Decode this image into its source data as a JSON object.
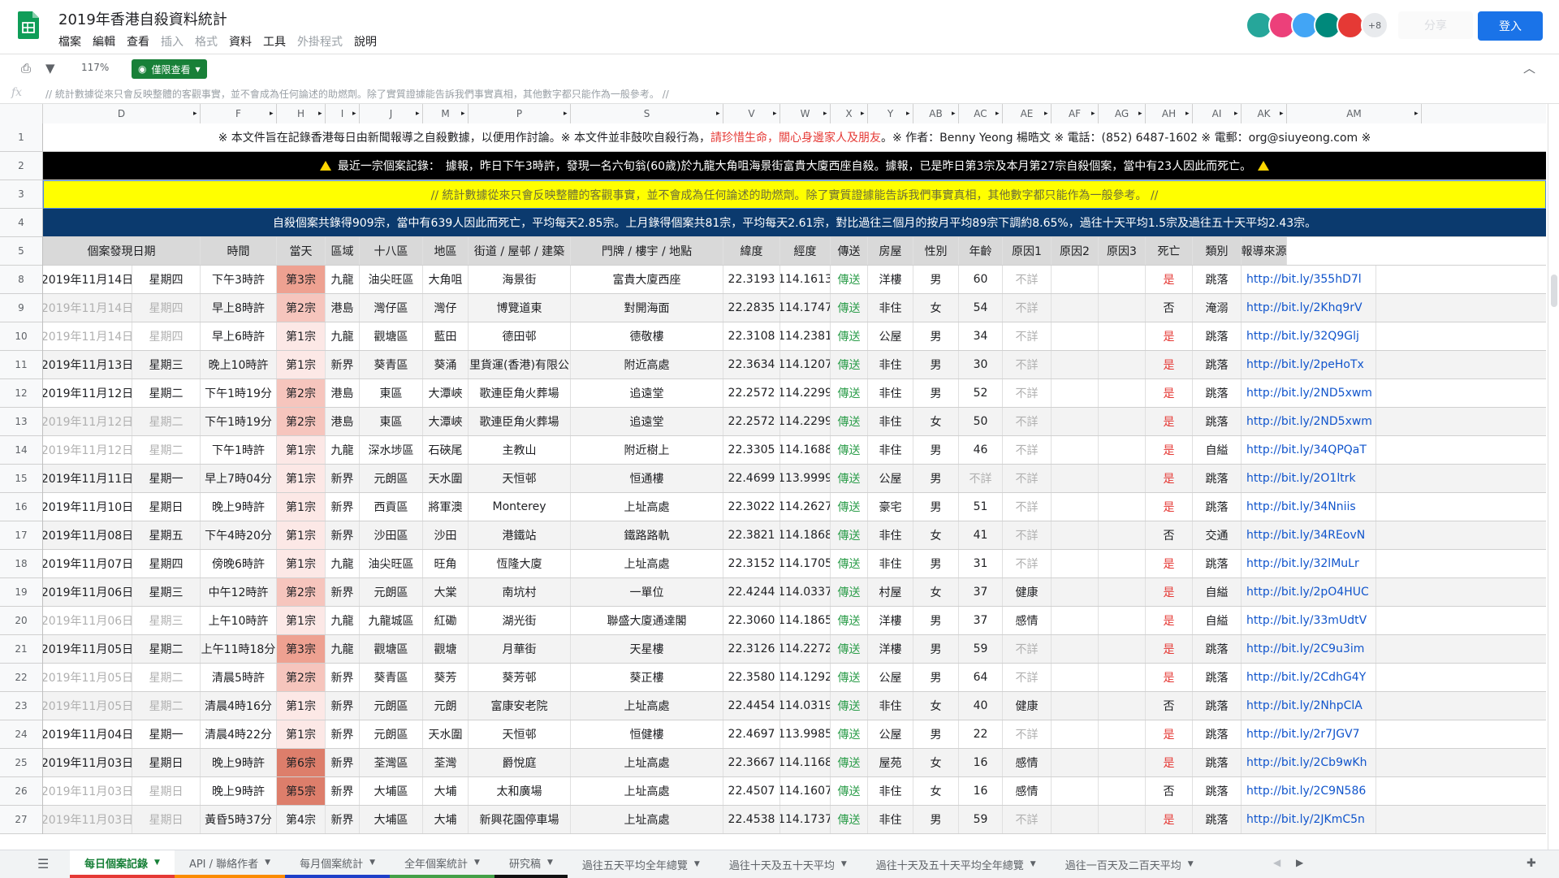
{
  "app": {
    "title": "2019年香港自殺資料統計",
    "menu": [
      "檔案",
      "編輯",
      "查看",
      "插入",
      "格式",
      "資料",
      "工具",
      "外掛程式",
      "說明"
    ],
    "menu_dim": [
      false,
      false,
      false,
      true,
      true,
      false,
      false,
      true,
      false
    ],
    "avatars_more": "+8",
    "share_label": "分享",
    "login_label": "登入"
  },
  "toolbar": {
    "zoom": "117%",
    "view_only_label": "僅限查看"
  },
  "formula": {
    "fx": "fx",
    "text": "// 統計數據從來只會反映整體的客觀事實，並不會成為任何論述的助燃劑。除了實質證據能告訴我們事實真相，其他數字都只能作為一般參考。 //"
  },
  "columns": [
    "D",
    "F",
    "H",
    "I",
    "J",
    "M",
    "P",
    "S",
    "V",
    "W",
    "X",
    "Y",
    "AB",
    "AC",
    "AE",
    "AF",
    "AG",
    "AH",
    "AI",
    "AK",
    "AM"
  ],
  "banners": {
    "row1_a": "※ 本文件旨在記錄香港每日由新聞報導之自殺數據，以便用作討論。※ 本文件並非鼓吹自殺行為，",
    "row1_red": "請珍惜生命，關心身邊家人及朋友",
    "row1_b": "。※ 作者：Benny Yeong 楊晧文 ※ 電話：(852) 6487-1602 ※ 電郵：org@siuyeong.com ※",
    "row2": "最近一宗個案記錄：　據報，昨日下午3時許，發現一名六旬翁(60歲)於九龍大角咀海景街富貴大廈西座自殺。據報，已是昨日第3宗及本月第27宗自殺個案，當中有23人因此而死亡。",
    "row3": "// 統計數據從來只會反映整體的客觀事實，並不會成為任何論述的助燃劑。除了實質證據能告訴我們事實真相，其他數字都只能作為一般參考。 //",
    "row4": "自殺個案共錄得909宗，當中有639人因此而死亡，平均每天2.85宗。上月錄得個案共81宗，平均每天2.61宗，對比過往三個月的按月平均89宗下調約8.65%，過往十天平均1.5宗及過往五十天平均2.43宗。"
  },
  "row_numbers": [
    "1",
    "2",
    "3",
    "4",
    "5",
    "8",
    "9",
    "10",
    "11",
    "12",
    "13",
    "14",
    "15",
    "16",
    "17",
    "18",
    "19",
    "20",
    "21",
    "22",
    "23",
    "24",
    "25",
    "26",
    "27"
  ],
  "table": {
    "headers": [
      "個案發現日期",
      "時間",
      "當天",
      "區域",
      "十八區",
      "地區",
      "街道 / 屋邨 / 建築",
      "門牌 / 樓宇 / 地點",
      "緯度",
      "經度",
      "傳送",
      "房屋",
      "性別",
      "年齡",
      "原因1",
      "原因2",
      "原因3",
      "死亡",
      "類別",
      "報導來源"
    ],
    "rows": [
      {
        "date": "2019年11月14日",
        "wd": "星期四",
        "time": "下午3時許",
        "n": "第3宗",
        "rg": "九龍",
        "d18": "油尖旺區",
        "area": "大角咀",
        "street": "海景街",
        "place": "富貴大廈西座",
        "lat": "22.3193",
        "lng": "114.1613",
        "tx": "傳送",
        "house": "洋樓",
        "sex": "男",
        "age": "60",
        "r1": "不詳",
        "dead": "是",
        "cat": "跳落",
        "src": "http://bit.ly/355hD7l",
        "dim": false,
        "lvl": 3
      },
      {
        "date": "2019年11月14日",
        "wd": "星期四",
        "time": "早上8時許",
        "n": "第2宗",
        "rg": "港島",
        "d18": "灣仔區",
        "area": "灣仔",
        "street": "博覽道東",
        "place": "對開海面",
        "lat": "22.2835",
        "lng": "114.1747",
        "tx": "傳送",
        "house": "非住",
        "sex": "女",
        "age": "54",
        "r1": "不詳",
        "dead": "否",
        "cat": "淹溺",
        "src": "http://bit.ly/2Khq9rV",
        "dim": true,
        "lvl": 2
      },
      {
        "date": "2019年11月14日",
        "wd": "星期四",
        "time": "早上6時許",
        "n": "第1宗",
        "rg": "九龍",
        "d18": "觀塘區",
        "area": "藍田",
        "street": "德田邨",
        "place": "德敬樓",
        "lat": "22.3108",
        "lng": "114.2381",
        "tx": "傳送",
        "house": "公屋",
        "sex": "男",
        "age": "34",
        "r1": "不詳",
        "dead": "是",
        "cat": "跳落",
        "src": "http://bit.ly/32Q9Glj",
        "dim": true,
        "lvl": 1
      },
      {
        "date": "2019年11月13日",
        "wd": "星期三",
        "time": "晚上10時許",
        "n": "第1宗",
        "rg": "新界",
        "d18": "葵青區",
        "area": "葵涌",
        "street": "嘉里貨運(香港)有限公司",
        "place": "附近高處",
        "lat": "22.3634",
        "lng": "114.1207",
        "tx": "傳送",
        "house": "非住",
        "sex": "男",
        "age": "30",
        "r1": "不詳",
        "dead": "是",
        "cat": "跳落",
        "src": "http://bit.ly/2peHoTx",
        "dim": false,
        "lvl": 1
      },
      {
        "date": "2019年11月12日",
        "wd": "星期二",
        "time": "下午1時19分",
        "n": "第2宗",
        "rg": "港島",
        "d18": "東區",
        "area": "大潭峽",
        "street": "歌連臣角火葬場",
        "place": "追遠堂",
        "lat": "22.2572",
        "lng": "114.2299",
        "tx": "傳送",
        "house": "非住",
        "sex": "男",
        "age": "52",
        "r1": "不詳",
        "dead": "是",
        "cat": "跳落",
        "src": "http://bit.ly/2ND5xwm",
        "dim": false,
        "lvl": 2
      },
      {
        "date": "2019年11月12日",
        "wd": "星期二",
        "time": "下午1時19分",
        "n": "第2宗",
        "rg": "港島",
        "d18": "東區",
        "area": "大潭峽",
        "street": "歌連臣角火葬場",
        "place": "追遠堂",
        "lat": "22.2572",
        "lng": "114.2299",
        "tx": "傳送",
        "house": "非住",
        "sex": "女",
        "age": "50",
        "r1": "不詳",
        "dead": "是",
        "cat": "跳落",
        "src": "http://bit.ly/2ND5xwm",
        "dim": true,
        "lvl": 2
      },
      {
        "date": "2019年11月12日",
        "wd": "星期二",
        "time": "下午1時許",
        "n": "第1宗",
        "rg": "九龍",
        "d18": "深水埗區",
        "area": "石硤尾",
        "street": "主教山",
        "place": "附近樹上",
        "lat": "22.3305",
        "lng": "114.1688",
        "tx": "傳送",
        "house": "非住",
        "sex": "男",
        "age": "46",
        "r1": "不詳",
        "dead": "是",
        "cat": "自縊",
        "src": "http://bit.ly/34QPQaT",
        "dim": true,
        "lvl": 1
      },
      {
        "date": "2019年11月11日",
        "wd": "星期一",
        "time": "早上7時04分",
        "n": "第1宗",
        "rg": "新界",
        "d18": "元朗區",
        "area": "天水圍",
        "street": "天恒邨",
        "place": "恒通樓",
        "lat": "22.4699",
        "lng": "113.9999",
        "tx": "傳送",
        "house": "公屋",
        "sex": "男",
        "age": "不詳",
        "r1": "不詳",
        "dead": "是",
        "cat": "跳落",
        "src": "http://bit.ly/2O1ltrk",
        "dim": false,
        "lvl": 1
      },
      {
        "date": "2019年11月10日",
        "wd": "星期日",
        "time": "晚上9時許",
        "n": "第1宗",
        "rg": "新界",
        "d18": "西貢區",
        "area": "將軍澳",
        "street": "Monterey",
        "place": "上址高處",
        "lat": "22.3022",
        "lng": "114.2627",
        "tx": "傳送",
        "house": "豪宅",
        "sex": "男",
        "age": "51",
        "r1": "不詳",
        "dead": "是",
        "cat": "跳落",
        "src": "http://bit.ly/34Nniis",
        "dim": false,
        "lvl": 1
      },
      {
        "date": "2019年11月08日",
        "wd": "星期五",
        "time": "下午4時20分",
        "n": "第1宗",
        "rg": "新界",
        "d18": "沙田區",
        "area": "沙田",
        "street": "港鐵站",
        "place": "鐵路路軌",
        "lat": "22.3821",
        "lng": "114.1868",
        "tx": "傳送",
        "house": "非住",
        "sex": "女",
        "age": "41",
        "r1": "不詳",
        "dead": "否",
        "cat": "交通",
        "src": "http://bit.ly/34REovN",
        "dim": false,
        "lvl": 1
      },
      {
        "date": "2019年11月07日",
        "wd": "星期四",
        "time": "傍晚6時許",
        "n": "第1宗",
        "rg": "九龍",
        "d18": "油尖旺區",
        "area": "旺角",
        "street": "恆隆大廈",
        "place": "上址高處",
        "lat": "22.3152",
        "lng": "114.1705",
        "tx": "傳送",
        "house": "非住",
        "sex": "男",
        "age": "31",
        "r1": "不詳",
        "dead": "是",
        "cat": "跳落",
        "src": "http://bit.ly/32lMuLr",
        "dim": false,
        "lvl": 1
      },
      {
        "date": "2019年11月06日",
        "wd": "星期三",
        "time": "中午12時許",
        "n": "第2宗",
        "rg": "新界",
        "d18": "元朗區",
        "area": "大棠",
        "street": "南坑村",
        "place": "一單位",
        "lat": "22.4244",
        "lng": "114.0337",
        "tx": "傳送",
        "house": "村屋",
        "sex": "女",
        "age": "37",
        "r1": "健康",
        "dead": "是",
        "cat": "自縊",
        "src": "http://bit.ly/2pO4HUC",
        "dim": false,
        "lvl": 2
      },
      {
        "date": "2019年11月06日",
        "wd": "星期三",
        "time": "上午10時許",
        "n": "第1宗",
        "rg": "九龍",
        "d18": "九龍城區",
        "area": "紅磡",
        "street": "湖光街",
        "place": "聯盛大廈通達閣",
        "lat": "22.3060",
        "lng": "114.1865",
        "tx": "傳送",
        "house": "洋樓",
        "sex": "男",
        "age": "37",
        "r1": "感情",
        "dead": "是",
        "cat": "自縊",
        "src": "http://bit.ly/33mUdtV",
        "dim": true,
        "lvl": 1
      },
      {
        "date": "2019年11月05日",
        "wd": "星期二",
        "time": "上午11時18分",
        "n": "第3宗",
        "rg": "九龍",
        "d18": "觀塘區",
        "area": "觀塘",
        "street": "月華街",
        "place": "天星樓",
        "lat": "22.3126",
        "lng": "114.2272",
        "tx": "傳送",
        "house": "洋樓",
        "sex": "男",
        "age": "59",
        "r1": "不詳",
        "dead": "是",
        "cat": "跳落",
        "src": "http://bit.ly/2C9u3im",
        "dim": false,
        "lvl": 3
      },
      {
        "date": "2019年11月05日",
        "wd": "星期二",
        "time": "清晨5時許",
        "n": "第2宗",
        "rg": "新界",
        "d18": "葵青區",
        "area": "葵芳",
        "street": "葵芳邨",
        "place": "葵正樓",
        "lat": "22.3580",
        "lng": "114.1292",
        "tx": "傳送",
        "house": "公屋",
        "sex": "男",
        "age": "64",
        "r1": "不詳",
        "dead": "是",
        "cat": "跳落",
        "src": "http://bit.ly/2CdhG4Y",
        "dim": true,
        "lvl": 2
      },
      {
        "date": "2019年11月05日",
        "wd": "星期二",
        "time": "清晨4時16分",
        "n": "第1宗",
        "rg": "新界",
        "d18": "元朗區",
        "area": "元朗",
        "street": "富康安老院",
        "place": "上址高處",
        "lat": "22.4454",
        "lng": "114.0319",
        "tx": "傳送",
        "house": "非住",
        "sex": "女",
        "age": "40",
        "r1": "健康",
        "dead": "否",
        "cat": "跳落",
        "src": "http://bit.ly/2NhpClA",
        "dim": true,
        "lvl": 1
      },
      {
        "date": "2019年11月04日",
        "wd": "星期一",
        "time": "清晨4時22分",
        "n": "第1宗",
        "rg": "新界",
        "d18": "元朗區",
        "area": "天水圍",
        "street": "天恒邨",
        "place": "恒健樓",
        "lat": "22.4697",
        "lng": "113.9985",
        "tx": "傳送",
        "house": "公屋",
        "sex": "男",
        "age": "22",
        "r1": "不詳",
        "dead": "是",
        "cat": "跳落",
        "src": "http://bit.ly/2r7JGV7",
        "dim": false,
        "lvl": 1
      },
      {
        "date": "2019年11月03日",
        "wd": "星期日",
        "time": "晚上9時許",
        "n": "第6宗",
        "rg": "新界",
        "d18": "荃灣區",
        "area": "荃灣",
        "street": "爵悅庭",
        "place": "上址高處",
        "lat": "22.3667",
        "lng": "114.1168",
        "tx": "傳送",
        "house": "屋苑",
        "sex": "女",
        "age": "16",
        "r1": "感情",
        "dead": "是",
        "cat": "跳落",
        "src": "http://bit.ly/2Cb9wKh",
        "dim": false,
        "lvl": 6
      },
      {
        "date": "2019年11月03日",
        "wd": "星期日",
        "time": "晚上9時許",
        "n": "第5宗",
        "rg": "新界",
        "d18": "大埔區",
        "area": "大埔",
        "street": "太和廣場",
        "place": "上址高處",
        "lat": "22.4507",
        "lng": "114.1607",
        "tx": "傳送",
        "house": "非住",
        "sex": "女",
        "age": "16",
        "r1": "感情",
        "dead": "否",
        "cat": "跳落",
        "src": "http://bit.ly/2C9N586",
        "dim": true,
        "lvl": 5
      },
      {
        "date": "2019年11月03日",
        "wd": "星期日",
        "time": "黃昏5時37分",
        "n": "第4宗",
        "rg": "新界",
        "d18": "大埔區",
        "area": "大埔",
        "street": "新興花園停車場",
        "place": "上址高處",
        "lat": "22.4538",
        "lng": "114.1737",
        "tx": "傳送",
        "house": "非住",
        "sex": "男",
        "age": "59",
        "r1": "不詳",
        "dead": "是",
        "cat": "跳落",
        "src": "http://bit.ly/2JKmC5n",
        "dim": true,
        "lvl": 4
      }
    ]
  },
  "tabs": [
    "每日個案記錄",
    "API / 聯絡作者",
    "每月個案統計",
    "全年個案統計",
    "研究稿",
    "過往五天平均全年總覽",
    "過往十天及五十天平均",
    "過往十天及五十天平均全年總覽",
    "過往一百天及二百天平均"
  ],
  "tab_colors": [
    "#e53935",
    "#fb8c00",
    "#1e40c8",
    "#43a047",
    "#111111",
    "",
    "",
    "",
    ""
  ],
  "colors": {
    "accent": "#1a73e8",
    "view_only": "#188038",
    "banner_black": "#000000",
    "banner_yellow": "#ffff00",
    "banner_navy": "#0b3a6e"
  }
}
